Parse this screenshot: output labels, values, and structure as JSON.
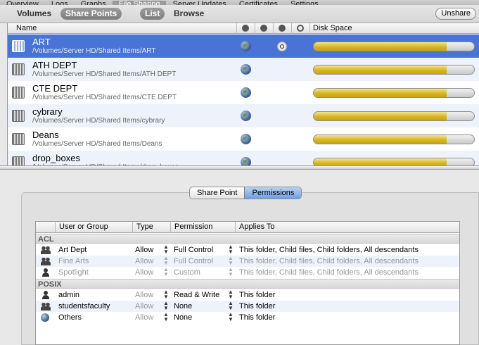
{
  "top_tabs": [
    "Overview",
    "Logs",
    "Graphs",
    "File Sharing",
    "Server Updates",
    "Certificates",
    "Settings"
  ],
  "top_tab_active": 3,
  "toolbar": {
    "volumes": "Volumes",
    "share_points": "Share Points",
    "list": "List",
    "browse": "Browse",
    "unshare": "Unshare"
  },
  "list_header": {
    "name": "Name",
    "disk_space": "Disk Space"
  },
  "share_points": [
    {
      "name": "ART",
      "path": "/Volumes/Server HD/Shared Items/ART",
      "selected": true,
      "spotlight": true,
      "usage": 0.83
    },
    {
      "name": "ATH DEPT",
      "path": "/Volumes/Server HD/Shared Items/ATH DEPT",
      "selected": false,
      "spotlight": false,
      "usage": 0.83
    },
    {
      "name": "CTE DEPT",
      "path": "/Volumes/Server HD/Shared Items/CTE DEPT",
      "selected": false,
      "spotlight": false,
      "usage": 0.83
    },
    {
      "name": "cybrary",
      "path": "/Volumes/Server HD/Shared Items/cybrary",
      "selected": false,
      "spotlight": false,
      "usage": 0.83
    },
    {
      "name": "Deans",
      "path": "/Volumes/Server HD/Shared Items/Deans",
      "selected": false,
      "spotlight": false,
      "usage": 0.83
    },
    {
      "name": "drop_boxes",
      "path": "/Volumes/Server HD/Shared Items/drop_boxes",
      "selected": false,
      "spotlight": false,
      "usage": 0.83
    }
  ],
  "segments": {
    "share_point": "Share Point",
    "permissions": "Permissions"
  },
  "perm_header": {
    "user_or_group": "User or Group",
    "type": "Type",
    "permission": "Permission",
    "applies_to": "Applies To"
  },
  "acl_label": "ACL",
  "posix_label": "POSIX",
  "acl_rows": [
    {
      "icon": "group",
      "name": "Art Dept",
      "type": "Allow",
      "permission": "Full Control",
      "applies": "This folder, Child files, Child folders, All descendants",
      "dim": false
    },
    {
      "icon": "group",
      "name": "Fine Arts",
      "type": "Allow",
      "permission": "Full Control",
      "applies": "This folder, Child files, Child folders, All descendants",
      "dim": true
    },
    {
      "icon": "user",
      "name": "Spotlight",
      "type": "Allow",
      "permission": "Custom",
      "applies": "This folder, Child files, Child folders, All descendants",
      "dim": true
    }
  ],
  "posix_rows": [
    {
      "icon": "user",
      "name": "admin",
      "type": "Allow",
      "permission": "Read & Write",
      "applies": "This folder"
    },
    {
      "icon": "group",
      "name": "studentsfaculty",
      "type": "Allow",
      "permission": "None",
      "applies": "This folder"
    },
    {
      "icon": "globe",
      "name": "Others",
      "type": "Allow",
      "permission": "None",
      "applies": "This folder"
    }
  ]
}
